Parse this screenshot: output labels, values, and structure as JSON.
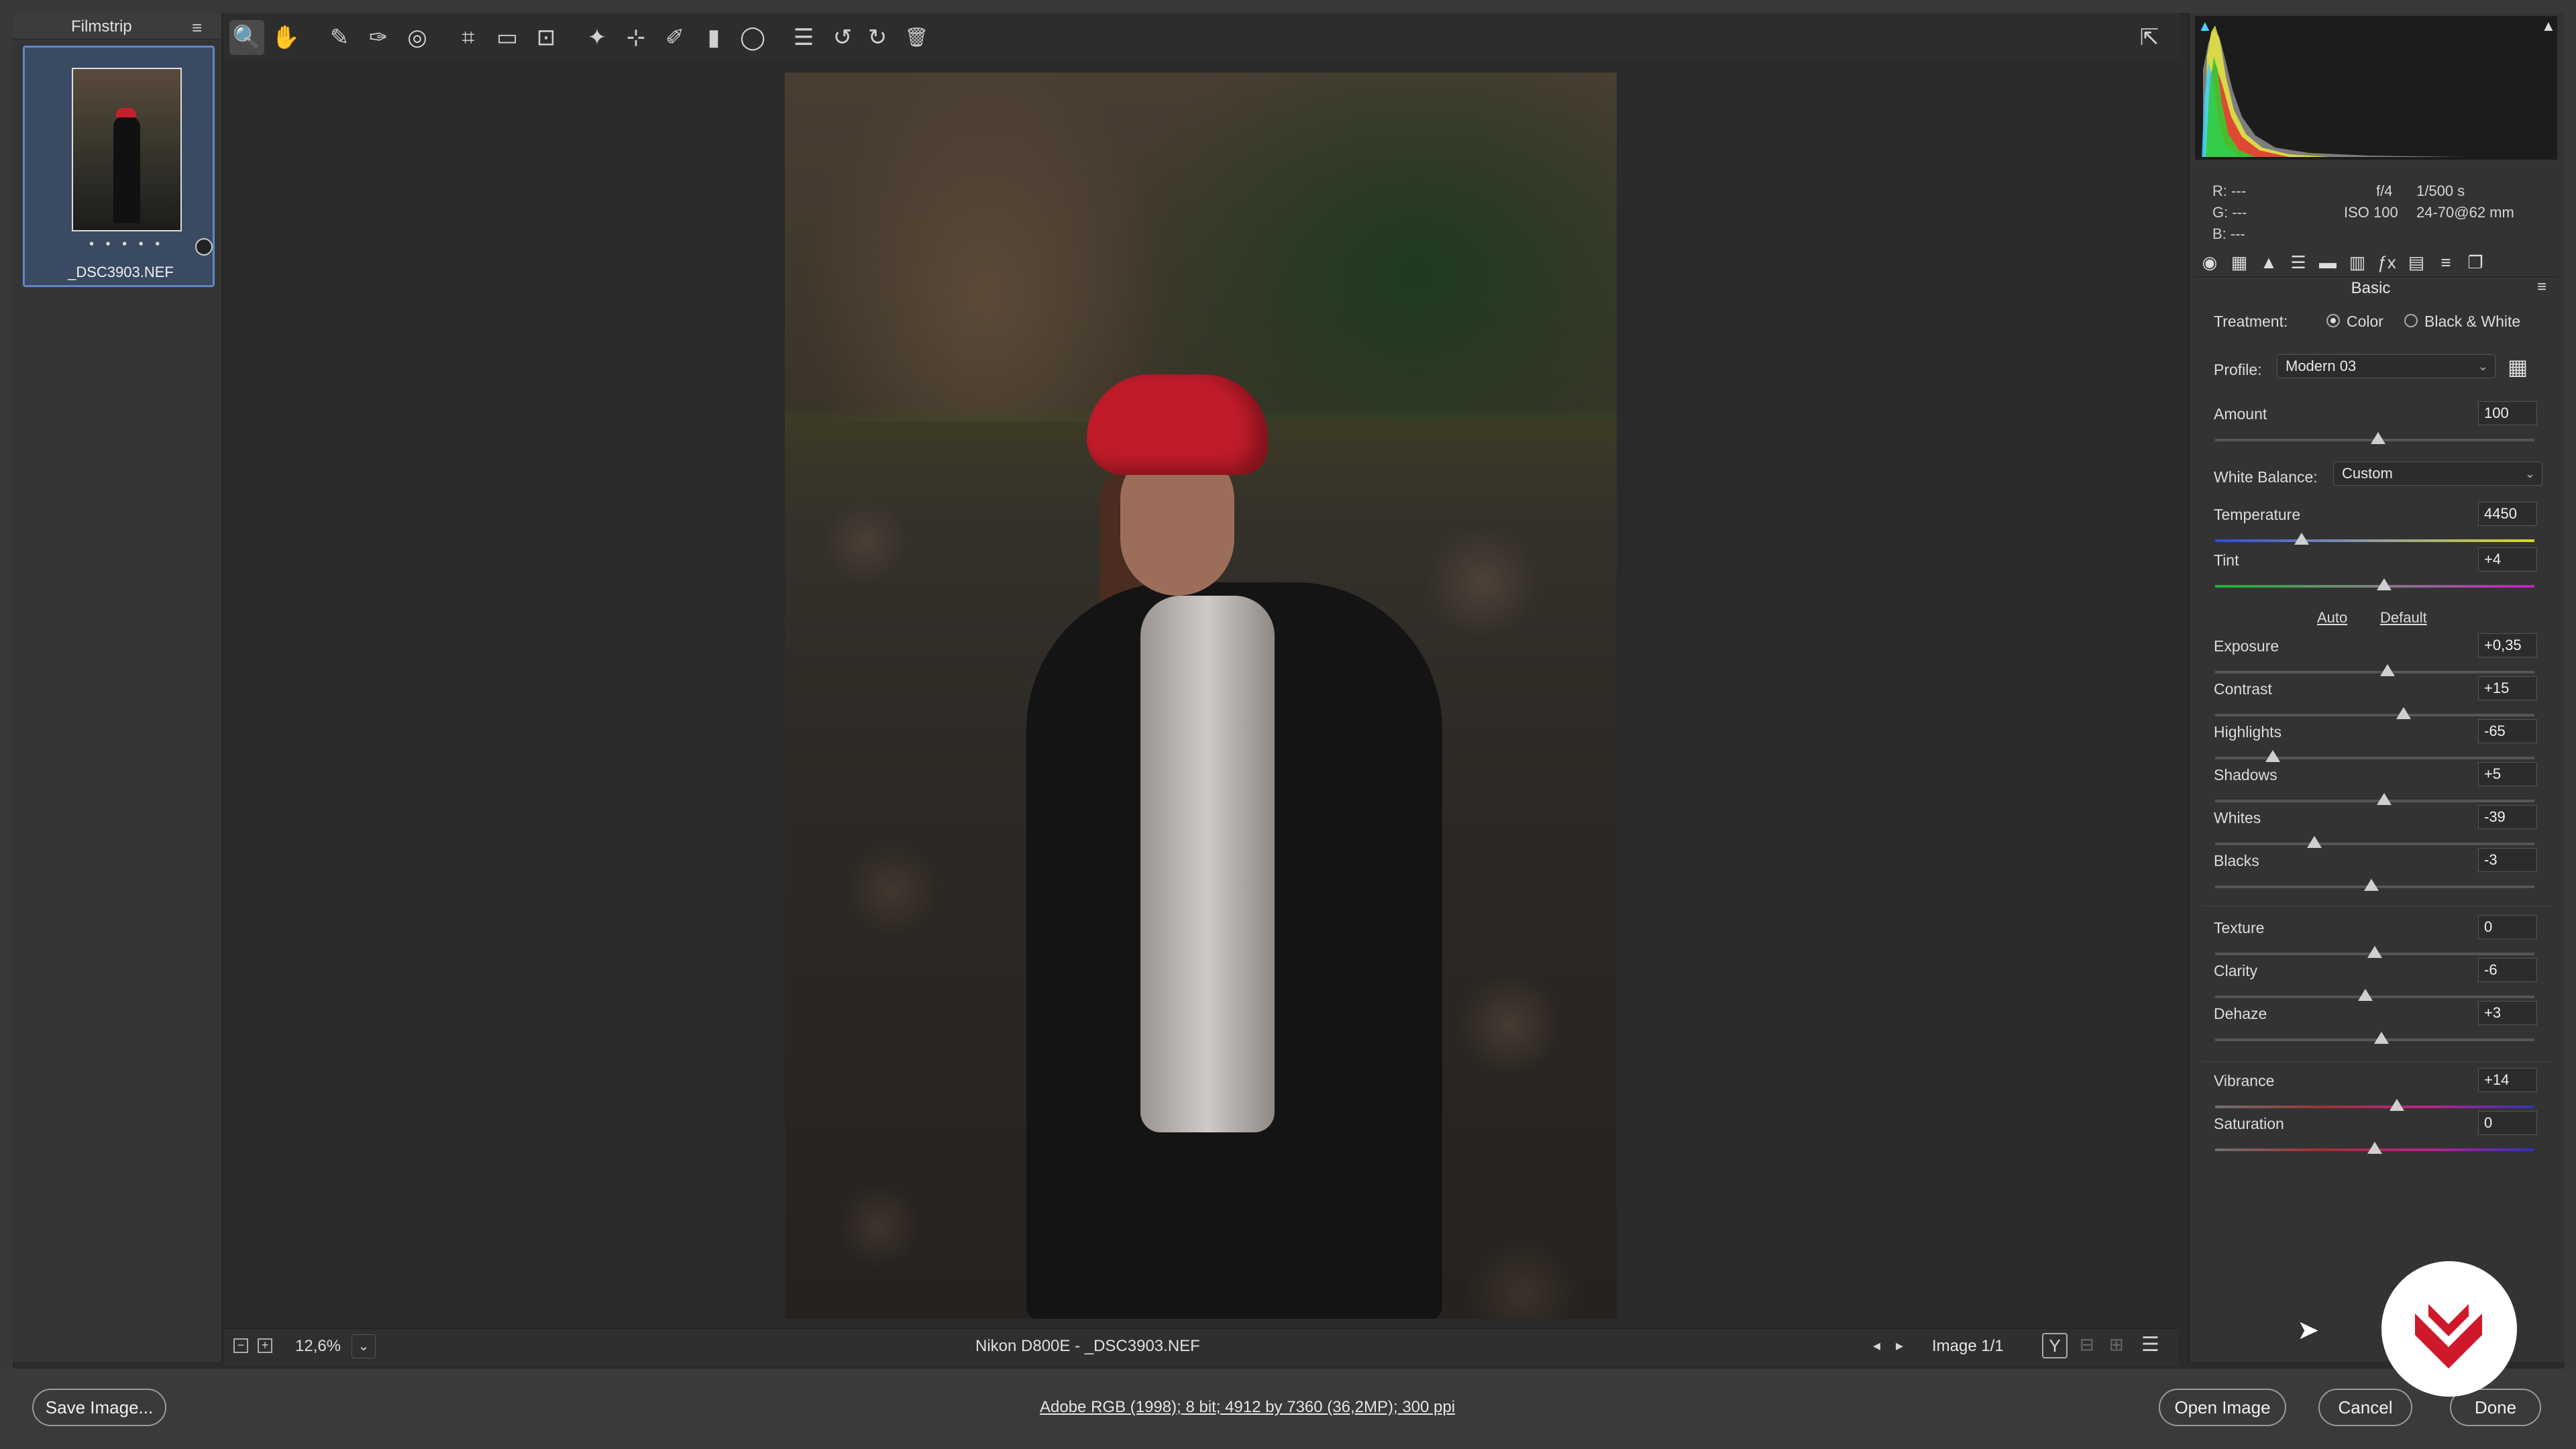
{
  "filmstrip": {
    "title": "Filmstrip",
    "menu_icon": "≡",
    "thumb_dots": "• • • • •",
    "file_name": "_DSC3903.NEF"
  },
  "toolbar": {
    "tools": [
      {
        "name": "zoom-tool",
        "glyph": "🔍"
      },
      {
        "name": "hand-tool",
        "glyph": "✋"
      },
      {
        "name": "white-balance-tool",
        "glyph": "✎"
      },
      {
        "name": "color-sampler-tool",
        "glyph": "✑"
      },
      {
        "name": "targeted-adjustment-tool",
        "glyph": "◎"
      },
      {
        "name": "crop-tool",
        "glyph": "⌗"
      },
      {
        "name": "straighten-tool",
        "glyph": "▭"
      },
      {
        "name": "transform-tool",
        "glyph": "⊡"
      },
      {
        "name": "spot-removal-tool",
        "glyph": "✦"
      },
      {
        "name": "red-eye-tool",
        "glyph": "⊹"
      },
      {
        "name": "adjustment-brush-tool",
        "glyph": "✐"
      },
      {
        "name": "graduated-filter-tool",
        "glyph": "▮"
      },
      {
        "name": "radial-filter-tool",
        "glyph": "◯"
      },
      {
        "name": "presets-list-tool",
        "glyph": "☰"
      },
      {
        "name": "rotate-left-tool",
        "glyph": "↺"
      },
      {
        "name": "rotate-right-tool",
        "glyph": "↻"
      },
      {
        "name": "trash-tool",
        "glyph": "🗑"
      }
    ],
    "open_prefs_glyph": "⇱"
  },
  "status": {
    "zoom_out": "−",
    "zoom_in": "+",
    "zoom": "12,6%",
    "zoom_caret": "⌄",
    "caption": "Nikon D800E  -  _DSC3903.NEF",
    "prev": "◂",
    "next": "▸",
    "image_count": "Image 1/1",
    "view_y": "Y",
    "view_b1": "⊟",
    "view_b2": "⊞",
    "settings_glyph": "☰"
  },
  "readout": {
    "r": "R:   ---",
    "g": "G:   ---",
    "b": "B:   ---",
    "aperture": "f/4",
    "shutter": "1/500 s",
    "iso": "ISO 100",
    "lens": "24-70@62 mm"
  },
  "panel_tabs": [
    "◉",
    "▦",
    "▲",
    "☰",
    "▬",
    "▥",
    "ƒx",
    "▤",
    "≡",
    "❐"
  ],
  "basic": {
    "title": "Basic",
    "treatment_label": "Treatment:",
    "color_label": "Color",
    "bw_label": "Black & White",
    "profile_label": "Profile:",
    "profile_value": "Modern 03",
    "profile_grid_glyph": "▦",
    "amount_label": "Amount",
    "amount_value": "100",
    "wb_label": "White Balance:",
    "wb_value": "Custom",
    "auto_label": "Auto",
    "default_label": "Default",
    "caret": "⌄"
  },
  "sliders": [
    {
      "key": "amount",
      "label": "Amount",
      "value": "100",
      "pos": 0.51
    },
    {
      "key": "temperature",
      "label": "Temperature",
      "value": "4450",
      "pos": 0.27
    },
    {
      "key": "tint",
      "label": "Tint",
      "value": "+4",
      "pos": 0.53
    },
    {
      "key": "exposure",
      "label": "Exposure",
      "value": "+0,35",
      "pos": 0.54
    },
    {
      "key": "contrast",
      "label": "Contrast",
      "value": "+15",
      "pos": 0.59
    },
    {
      "key": "highlights",
      "label": "Highlights",
      "value": "-65",
      "pos": 0.18
    },
    {
      "key": "shadows",
      "label": "Shadows",
      "value": "+5",
      "pos": 0.53
    },
    {
      "key": "whites",
      "label": "Whites",
      "value": "-39",
      "pos": 0.31
    },
    {
      "key": "blacks",
      "label": "Blacks",
      "value": "-3",
      "pos": 0.49
    },
    {
      "key": "texture",
      "label": "Texture",
      "value": "0",
      "pos": 0.5
    },
    {
      "key": "clarity",
      "label": "Clarity",
      "value": "-6",
      "pos": 0.47
    },
    {
      "key": "dehaze",
      "label": "Dehaze",
      "value": "+3",
      "pos": 0.52
    },
    {
      "key": "vibrance",
      "label": "Vibrance",
      "value": "+14",
      "pos": 0.57
    },
    {
      "key": "saturation",
      "label": "Saturation",
      "value": "0",
      "pos": 0.5
    }
  ],
  "footer": {
    "save": "Save Image...",
    "workflow": "Adobe RGB (1998); 8 bit; 4912 by 7360 (36,2MP); 300 ppi",
    "open": "Open Image",
    "cancel": "Cancel",
    "done": "Done"
  },
  "colors": {
    "accent_blue": "#5f87c4",
    "logo_red": "#d0182b"
  }
}
